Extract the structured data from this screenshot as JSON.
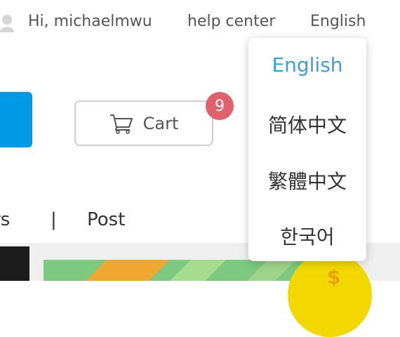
{
  "header": {
    "greeting": "Hi, michaelmwu",
    "help_center": "help center",
    "language": "English"
  },
  "cart": {
    "label": "Cart",
    "count": "9"
  },
  "nav": {
    "prev_partial": "rs",
    "separator": "|",
    "post": "Post"
  },
  "language_menu": {
    "items": [
      {
        "label": "English",
        "selected": true
      },
      {
        "label": "简体中文",
        "selected": false
      },
      {
        "label": "繁體中文",
        "selected": false
      },
      {
        "label": "한국어",
        "selected": false
      }
    ]
  },
  "colors": {
    "accent": "#3aa0d8",
    "primary_button": "#0099e5",
    "badge": "#e0606c",
    "coin": "#f2d800"
  },
  "icons": [
    "user-icon",
    "cart-icon",
    "coin-icon"
  ]
}
